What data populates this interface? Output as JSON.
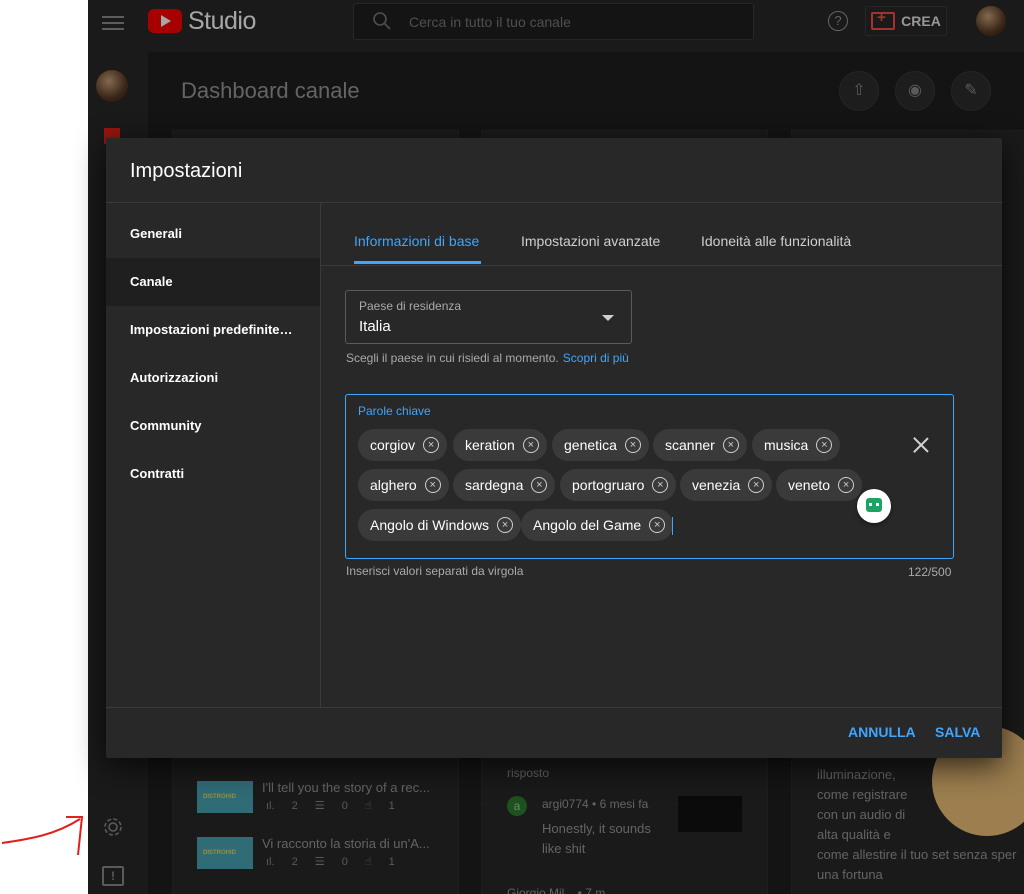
{
  "app": {
    "logo_text": "Studio",
    "search": {
      "placeholder": "Cerca in tutto il tuo canale"
    },
    "create_label": "CREA",
    "help_symbol": "?",
    "icons": [
      "menu-icon",
      "search-icon",
      "help-icon",
      "create-icon",
      "gear-icon",
      "feedback-icon"
    ]
  },
  "dashboard": {
    "title": "Dashboard canale",
    "videos": [
      {
        "title": "I'll tell you the story of a rec...",
        "views": "2",
        "comments": "0",
        "likes": "1",
        "thumb_text": "DISTROHID"
      },
      {
        "title": "Vi racconto la storia di un'A...",
        "views": "2",
        "comments": "0",
        "likes": "1",
        "thumb_text": "DISTROHID"
      }
    ],
    "comments_header": "risposto",
    "comment": {
      "author": "argi0774 • 6 mesi fa",
      "avatar": "a",
      "text_line1": "Honestly, it sounds",
      "text_line2": "like shit"
    },
    "next_comment_author": "Giorgio Mil...  • 7 m",
    "ideas": [
      "illuminazione,",
      "come registrare",
      "con un audio di",
      "alta qualità e",
      "come allestire il tuo set senza sper",
      "una fortuna"
    ]
  },
  "dialog": {
    "title": "Impostazioni",
    "nav": [
      {
        "label": "Generali",
        "active": false
      },
      {
        "label": "Canale",
        "active": true
      },
      {
        "label": "Impostazioni predefinite vi...",
        "active": false
      },
      {
        "label": "Autorizzazioni",
        "active": false
      },
      {
        "label": "Community",
        "active": false
      },
      {
        "label": "Contratti",
        "active": false
      }
    ],
    "tabs": [
      {
        "label": "Informazioni di base",
        "active": true
      },
      {
        "label": "Impostazioni avanzate",
        "active": false
      },
      {
        "label": "Idoneità alle funzionalità",
        "active": false
      }
    ],
    "country": {
      "label": "Paese di residenza",
      "value": "Italia",
      "help": "Scegli il paese in cui risiedi al momento.",
      "link": "Scopri di più"
    },
    "keywords": {
      "label": "Parole chiave",
      "chips": [
        "corgiov",
        "keration",
        "genetica",
        "scanner",
        "musica",
        "alghero",
        "sardegna",
        "portogruaro",
        "venezia",
        "veneto",
        "Angolo di Windows",
        "Angolo del Game"
      ],
      "help": "Inserisci valori separati da virgola",
      "count": "122/500"
    },
    "buttons": {
      "cancel": "ANNULLA",
      "save": "SALVA"
    }
  },
  "colors": {
    "accent": "#3ea6ff",
    "brand_red": "#ff0000",
    "annotation_red": "#e0201c"
  }
}
